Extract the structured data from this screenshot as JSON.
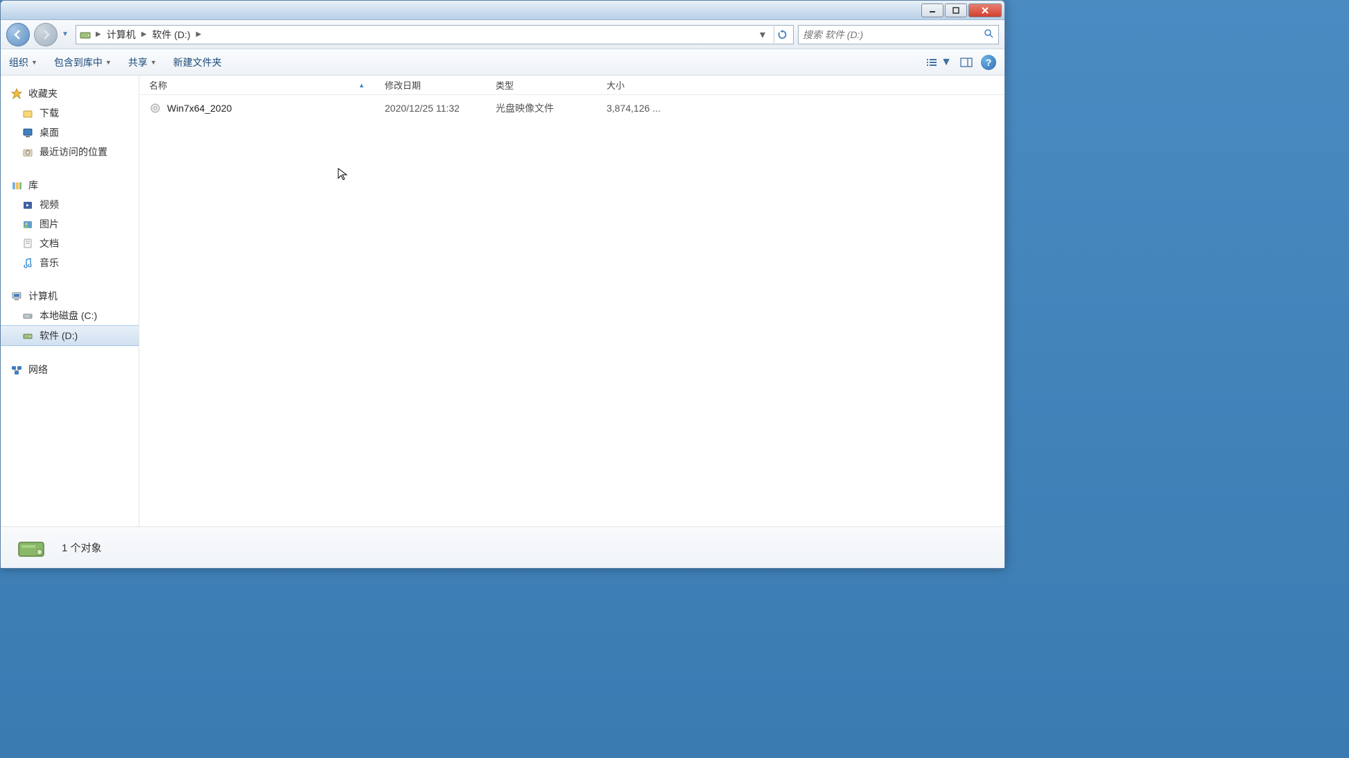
{
  "breadcrumb": {
    "item0": "计算机",
    "item1": "软件 (D:)"
  },
  "search": {
    "placeholder": "搜索 软件 (D:)"
  },
  "toolbar": {
    "organize": "组织",
    "include": "包含到库中",
    "share": "共享",
    "new_folder": "新建文件夹"
  },
  "nav": {
    "favorites": "收藏夹",
    "downloads": "下载",
    "desktop": "桌面",
    "recent": "最近访问的位置",
    "libraries": "库",
    "videos": "视频",
    "pictures": "图片",
    "documents": "文档",
    "music": "音乐",
    "computer": "计算机",
    "local_c": "本地磁盘 (C:)",
    "software_d": "软件 (D:)",
    "network": "网络"
  },
  "columns": {
    "name": "名称",
    "date": "修改日期",
    "type": "类型",
    "size": "大小"
  },
  "files": [
    {
      "name": "Win7x64_2020",
      "date": "2020/12/25 11:32",
      "type": "光盘映像文件",
      "size": "3,874,126 ..."
    }
  ],
  "status": {
    "text": "1 个对象"
  }
}
